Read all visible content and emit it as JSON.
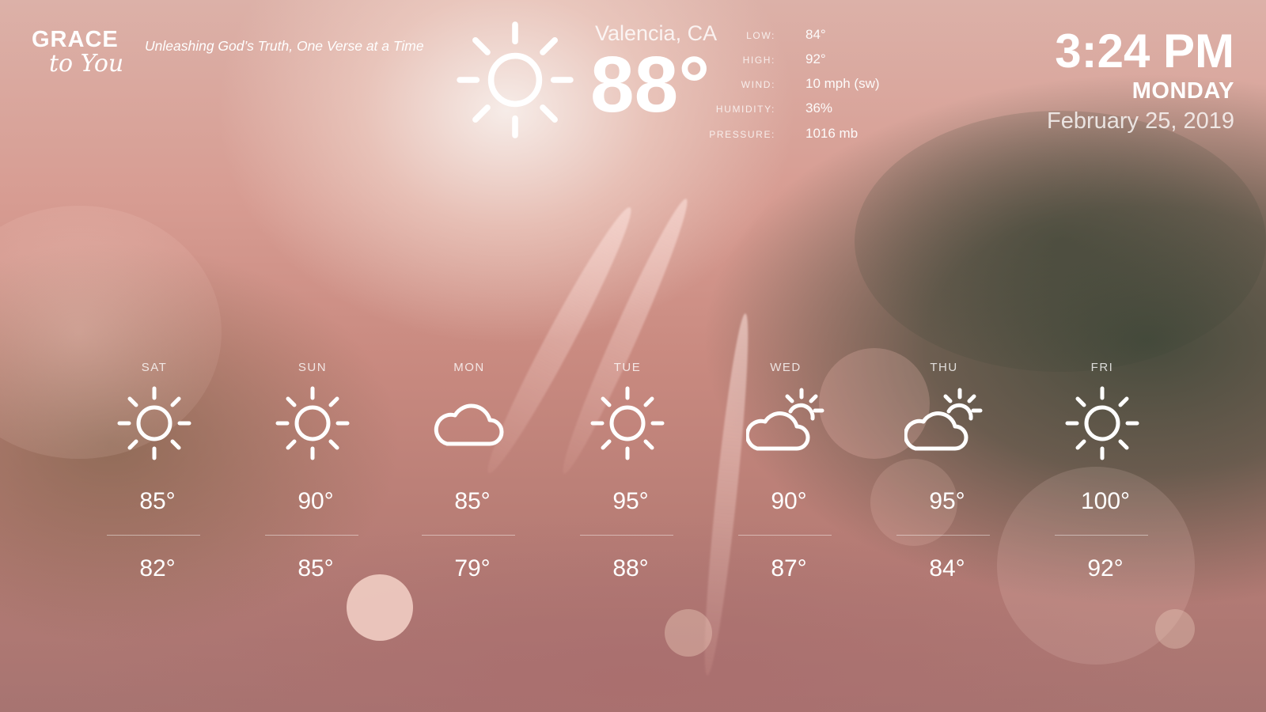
{
  "brand": {
    "logo_line1": "GRACE",
    "logo_line2": "to You",
    "tagline": "Unleashing God’s Truth, One Verse at a Time"
  },
  "current": {
    "location": "Valencia, CA",
    "temperature": "88°",
    "icon": "sun-icon",
    "stats": [
      {
        "label": "LOW:",
        "value": "84°"
      },
      {
        "label": "HIGH:",
        "value": "92°"
      },
      {
        "label": "WIND:",
        "value": "10 mph (sw)"
      },
      {
        "label": "HUMIDITY:",
        "value": "36%"
      },
      {
        "label": "PRESSURE:",
        "value": "1016 mb"
      }
    ]
  },
  "clock": {
    "time": "3:24 PM",
    "weekday": "MONDAY",
    "date": "February 25,  2019"
  },
  "forecast": [
    {
      "day": "SAT",
      "icon": "sun-icon",
      "high": "85°",
      "low": "82°"
    },
    {
      "day": "SUN",
      "icon": "sun-icon",
      "high": "90°",
      "low": "85°"
    },
    {
      "day": "MON",
      "icon": "cloud-icon",
      "high": "85°",
      "low": "79°"
    },
    {
      "day": "TUE",
      "icon": "sun-icon",
      "high": "95°",
      "low": "88°"
    },
    {
      "day": "WED",
      "icon": "partly-cloudy-icon",
      "high": "90°",
      "low": "87°"
    },
    {
      "day": "THU",
      "icon": "partly-cloudy-icon",
      "high": "95°",
      "low": "84°"
    },
    {
      "day": "FRI",
      "icon": "sun-icon",
      "high": "100°",
      "low": "92°"
    }
  ],
  "colors": {
    "text": "#ffffff",
    "muted_text": "rgba(255,255,255,0.8)",
    "background_warm": "#d79c92",
    "background_dark": "#505a4a"
  }
}
